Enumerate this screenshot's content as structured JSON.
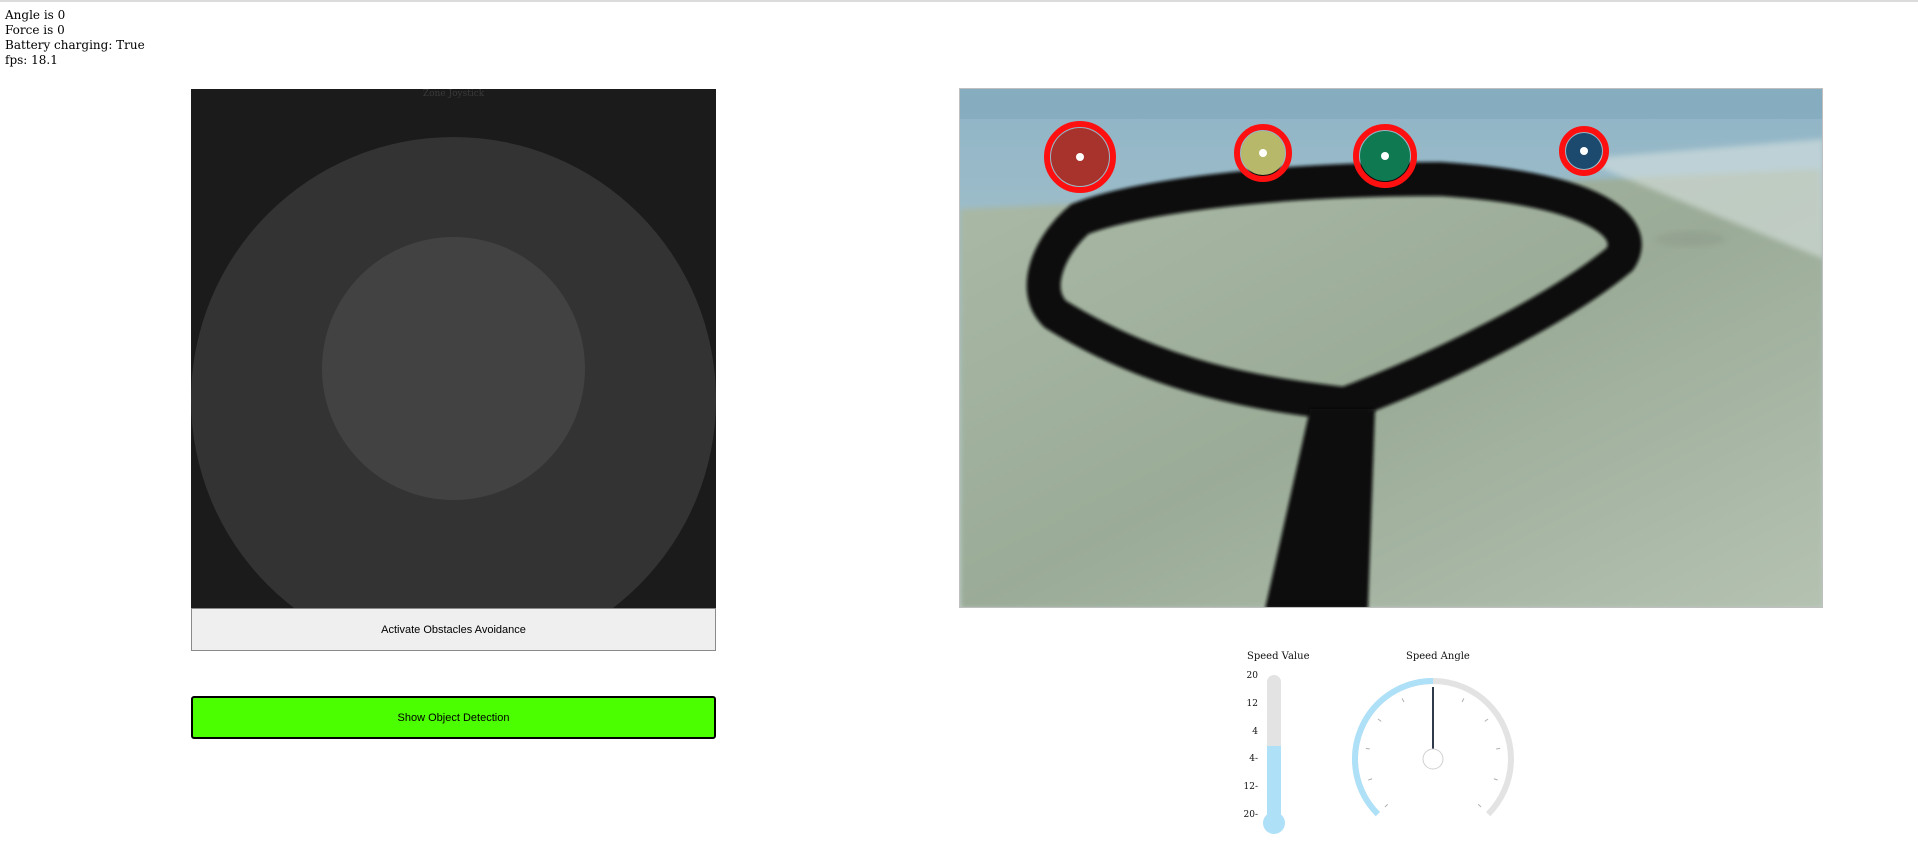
{
  "status": {
    "angle": "Angle is 0",
    "force": "Force is 0",
    "battery": "Battery charging: True",
    "fps": "fps: 18.1"
  },
  "joystick": {
    "zone_label": "Zone Joystick"
  },
  "buttons": {
    "avoidance": "Activate Obstacles Avoidance",
    "detection": "Show Object Detection",
    "detection_color": "#4cff00"
  },
  "camera": {
    "detected_objects": [
      {
        "name": "red-ball",
        "color": "#a8322c"
      },
      {
        "name": "yellow-ball",
        "color": "#b8b86a"
      },
      {
        "name": "green-ball",
        "color": "#0f7a52"
      },
      {
        "name": "blue-ball",
        "color": "#1b4a6e"
      }
    ],
    "marker_color": "#ff1010"
  },
  "speed_value": {
    "title": "Speed Value",
    "ticks": [
      "20",
      "12",
      "4",
      "4-",
      "12-",
      "20-"
    ],
    "value_fraction": 0.5,
    "fill_color": "#aee0f7"
  },
  "speed_angle": {
    "title": "Speed Angle",
    "value_fraction": 0.5,
    "arc_color": "#aee0f7",
    "needle_color": "#2f3a4a"
  }
}
